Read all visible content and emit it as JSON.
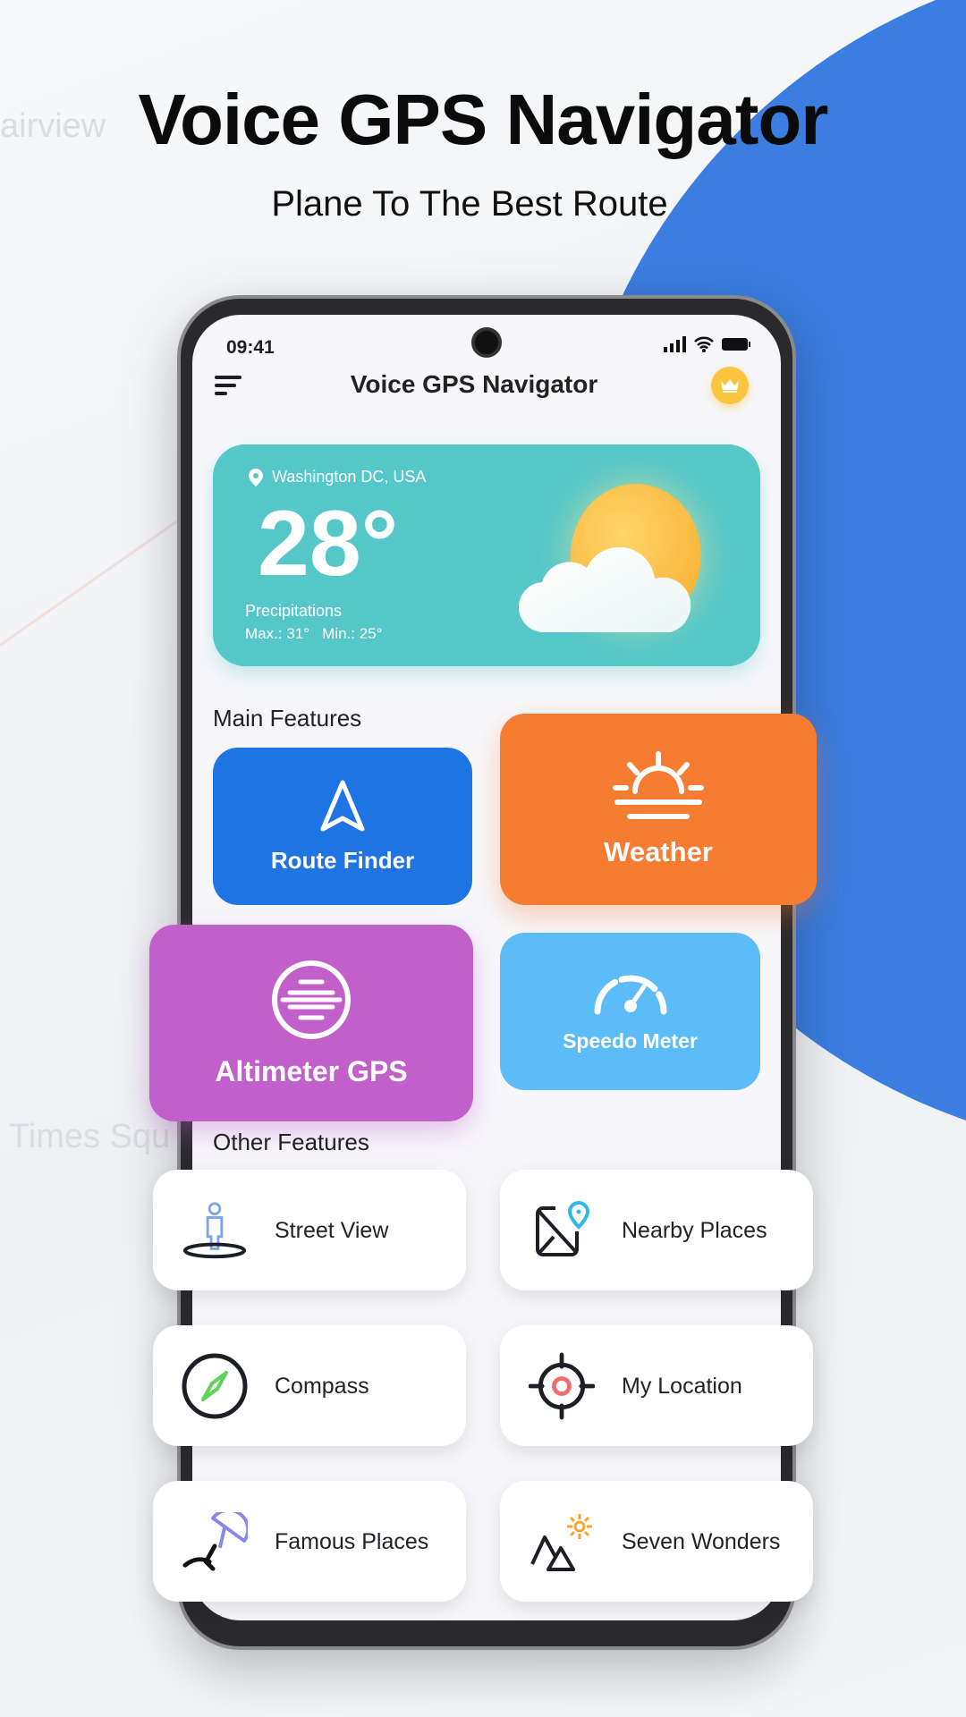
{
  "hero": {
    "title": "Voice GPS Navigator",
    "subtitle": "Plane To The Best Route"
  },
  "status_bar": {
    "time": "09:41"
  },
  "app_bar": {
    "title": "Voice GPS Navigator",
    "menu_icon": "menu-icon",
    "premium_icon": "crown-icon"
  },
  "weather_card": {
    "location": "Washington DC, USA",
    "temperature": "28°",
    "condition": "Precipitations",
    "max_min": "Max.: 31°   Min.: 25°"
  },
  "main_features": {
    "heading": "Main Features",
    "items": [
      {
        "label": "Route Finder",
        "icon": "navigation-arrow-icon",
        "color": "#1f74e3"
      },
      {
        "label": "Weather",
        "icon": "sunrise-icon",
        "color": "#f57c30"
      },
      {
        "label": "Altimeter GPS",
        "icon": "altimeter-icon",
        "color": "#c15fcb"
      },
      {
        "label": "Speedo Meter",
        "icon": "speedometer-icon",
        "color": "#5bbcf7"
      }
    ]
  },
  "other_features": {
    "heading": "Other Features",
    "items": [
      {
        "label": "Street View",
        "icon": "street-view-icon"
      },
      {
        "label": "Nearby Places",
        "icon": "map-pin-icon"
      },
      {
        "label": "Compass",
        "icon": "compass-icon"
      },
      {
        "label": "My Location",
        "icon": "crosshair-icon"
      },
      {
        "label": "Famous Places",
        "icon": "beach-umbrella-icon"
      },
      {
        "label": "Seven Wonders",
        "icon": "mountains-sun-icon"
      }
    ]
  },
  "colors": {
    "accent_blue": "#3b7de0",
    "weather_teal": "#55c7c9",
    "crown": "#fcc540"
  }
}
